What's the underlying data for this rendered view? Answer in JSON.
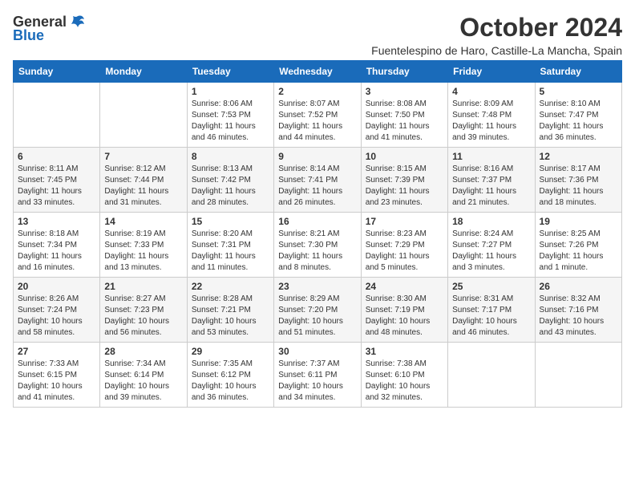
{
  "header": {
    "logo_general": "General",
    "logo_blue": "Blue",
    "month": "October 2024",
    "location": "Fuentelespino de Haro, Castille-La Mancha, Spain"
  },
  "weekdays": [
    "Sunday",
    "Monday",
    "Tuesday",
    "Wednesday",
    "Thursday",
    "Friday",
    "Saturday"
  ],
  "weeks": [
    [
      {
        "day": "",
        "info": ""
      },
      {
        "day": "",
        "info": ""
      },
      {
        "day": "1",
        "info": "Sunrise: 8:06 AM\nSunset: 7:53 PM\nDaylight: 11 hours and 46 minutes."
      },
      {
        "day": "2",
        "info": "Sunrise: 8:07 AM\nSunset: 7:52 PM\nDaylight: 11 hours and 44 minutes."
      },
      {
        "day": "3",
        "info": "Sunrise: 8:08 AM\nSunset: 7:50 PM\nDaylight: 11 hours and 41 minutes."
      },
      {
        "day": "4",
        "info": "Sunrise: 8:09 AM\nSunset: 7:48 PM\nDaylight: 11 hours and 39 minutes."
      },
      {
        "day": "5",
        "info": "Sunrise: 8:10 AM\nSunset: 7:47 PM\nDaylight: 11 hours and 36 minutes."
      }
    ],
    [
      {
        "day": "6",
        "info": "Sunrise: 8:11 AM\nSunset: 7:45 PM\nDaylight: 11 hours and 33 minutes."
      },
      {
        "day": "7",
        "info": "Sunrise: 8:12 AM\nSunset: 7:44 PM\nDaylight: 11 hours and 31 minutes."
      },
      {
        "day": "8",
        "info": "Sunrise: 8:13 AM\nSunset: 7:42 PM\nDaylight: 11 hours and 28 minutes."
      },
      {
        "day": "9",
        "info": "Sunrise: 8:14 AM\nSunset: 7:41 PM\nDaylight: 11 hours and 26 minutes."
      },
      {
        "day": "10",
        "info": "Sunrise: 8:15 AM\nSunset: 7:39 PM\nDaylight: 11 hours and 23 minutes."
      },
      {
        "day": "11",
        "info": "Sunrise: 8:16 AM\nSunset: 7:37 PM\nDaylight: 11 hours and 21 minutes."
      },
      {
        "day": "12",
        "info": "Sunrise: 8:17 AM\nSunset: 7:36 PM\nDaylight: 11 hours and 18 minutes."
      }
    ],
    [
      {
        "day": "13",
        "info": "Sunrise: 8:18 AM\nSunset: 7:34 PM\nDaylight: 11 hours and 16 minutes."
      },
      {
        "day": "14",
        "info": "Sunrise: 8:19 AM\nSunset: 7:33 PM\nDaylight: 11 hours and 13 minutes."
      },
      {
        "day": "15",
        "info": "Sunrise: 8:20 AM\nSunset: 7:31 PM\nDaylight: 11 hours and 11 minutes."
      },
      {
        "day": "16",
        "info": "Sunrise: 8:21 AM\nSunset: 7:30 PM\nDaylight: 11 hours and 8 minutes."
      },
      {
        "day": "17",
        "info": "Sunrise: 8:23 AM\nSunset: 7:29 PM\nDaylight: 11 hours and 5 minutes."
      },
      {
        "day": "18",
        "info": "Sunrise: 8:24 AM\nSunset: 7:27 PM\nDaylight: 11 hours and 3 minutes."
      },
      {
        "day": "19",
        "info": "Sunrise: 8:25 AM\nSunset: 7:26 PM\nDaylight: 11 hours and 1 minute."
      }
    ],
    [
      {
        "day": "20",
        "info": "Sunrise: 8:26 AM\nSunset: 7:24 PM\nDaylight: 10 hours and 58 minutes."
      },
      {
        "day": "21",
        "info": "Sunrise: 8:27 AM\nSunset: 7:23 PM\nDaylight: 10 hours and 56 minutes."
      },
      {
        "day": "22",
        "info": "Sunrise: 8:28 AM\nSunset: 7:21 PM\nDaylight: 10 hours and 53 minutes."
      },
      {
        "day": "23",
        "info": "Sunrise: 8:29 AM\nSunset: 7:20 PM\nDaylight: 10 hours and 51 minutes."
      },
      {
        "day": "24",
        "info": "Sunrise: 8:30 AM\nSunset: 7:19 PM\nDaylight: 10 hours and 48 minutes."
      },
      {
        "day": "25",
        "info": "Sunrise: 8:31 AM\nSunset: 7:17 PM\nDaylight: 10 hours and 46 minutes."
      },
      {
        "day": "26",
        "info": "Sunrise: 8:32 AM\nSunset: 7:16 PM\nDaylight: 10 hours and 43 minutes."
      }
    ],
    [
      {
        "day": "27",
        "info": "Sunrise: 7:33 AM\nSunset: 6:15 PM\nDaylight: 10 hours and 41 minutes."
      },
      {
        "day": "28",
        "info": "Sunrise: 7:34 AM\nSunset: 6:14 PM\nDaylight: 10 hours and 39 minutes."
      },
      {
        "day": "29",
        "info": "Sunrise: 7:35 AM\nSunset: 6:12 PM\nDaylight: 10 hours and 36 minutes."
      },
      {
        "day": "30",
        "info": "Sunrise: 7:37 AM\nSunset: 6:11 PM\nDaylight: 10 hours and 34 minutes."
      },
      {
        "day": "31",
        "info": "Sunrise: 7:38 AM\nSunset: 6:10 PM\nDaylight: 10 hours and 32 minutes."
      },
      {
        "day": "",
        "info": ""
      },
      {
        "day": "",
        "info": ""
      }
    ]
  ]
}
